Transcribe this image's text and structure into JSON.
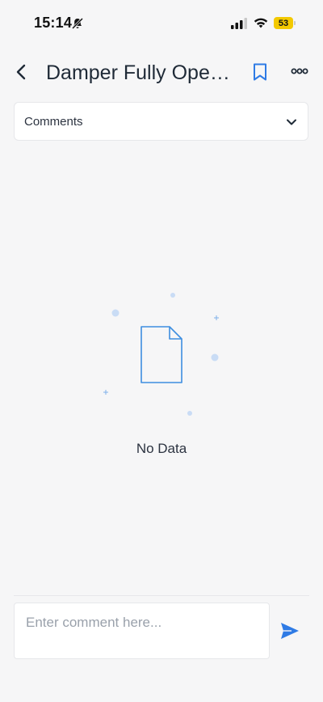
{
  "status_bar": {
    "time": "15:14",
    "battery_level": "53",
    "icons": [
      "bell-slash-icon",
      "signal-icon",
      "wifi-icon",
      "battery-icon"
    ]
  },
  "header": {
    "title": "Damper Fully Open...",
    "icons": [
      "back-arrow-icon",
      "bookmark-icon",
      "more-icon"
    ]
  },
  "comments_dropdown": {
    "label": "Comments"
  },
  "empty_state": {
    "text": "No Data"
  },
  "composer": {
    "placeholder": "Enter comment here..."
  },
  "colors": {
    "accent": "#2f7be5",
    "background": "#f6f6f7",
    "battery": "#f3c900"
  }
}
